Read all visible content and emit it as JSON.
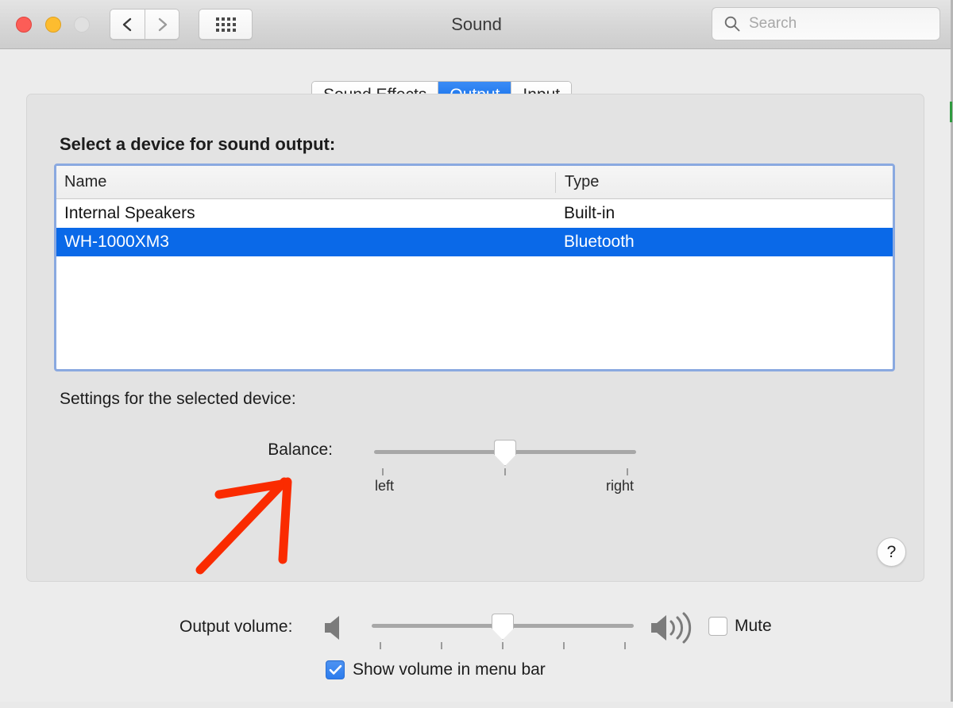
{
  "window": {
    "title": "Sound",
    "traffic_lights": [
      "close",
      "minimize",
      "zoom"
    ],
    "nav": {
      "back_icon": "chevron-left-icon",
      "forward_icon": "chevron-right-icon",
      "grid_icon": "grid-apps-icon"
    }
  },
  "search": {
    "placeholder": "Search",
    "value": "",
    "icon": "search-icon"
  },
  "tabs": [
    {
      "label": "Sound Effects",
      "selected": false
    },
    {
      "label": "Output",
      "selected": true
    },
    {
      "label": "Input",
      "selected": false
    }
  ],
  "panel": {
    "heading": "Select a device for sound output:",
    "settings_label": "Settings for the selected device:",
    "help_label": "?"
  },
  "device_table": {
    "columns": [
      "Name",
      "Type"
    ],
    "rows": [
      {
        "name": "Internal Speakers",
        "type": "Built-in",
        "selected": false
      },
      {
        "name": "WH-1000XM3",
        "type": "Bluetooth",
        "selected": true
      }
    ]
  },
  "balance": {
    "label": "Balance:",
    "left_tick_label": "left",
    "right_tick_label": "right",
    "value_percent": 50
  },
  "output_volume": {
    "label": "Output volume:",
    "min_icon": "speaker-mute-icon",
    "max_icon": "speaker-loud-icon",
    "value_percent": 50,
    "tick_count": 5
  },
  "mute": {
    "label": "Mute",
    "checked": false
  },
  "show_volume_menu_bar": {
    "label": "Show volume in menu bar",
    "checked": true
  },
  "annotation": {
    "type": "hand-drawn-arrow",
    "color": "#fa2b00",
    "points_at": "Balance:"
  },
  "colors": {
    "accent_blue": "#0a69e8",
    "tab_selected_blue": "#1b7fec",
    "focus_ring": "#8aa9e0",
    "checkbox_blue": "#2d7ced",
    "annotation_red": "#fa2b00",
    "window_bg": "#ececec",
    "panel_bg": "#e3e3e3"
  }
}
